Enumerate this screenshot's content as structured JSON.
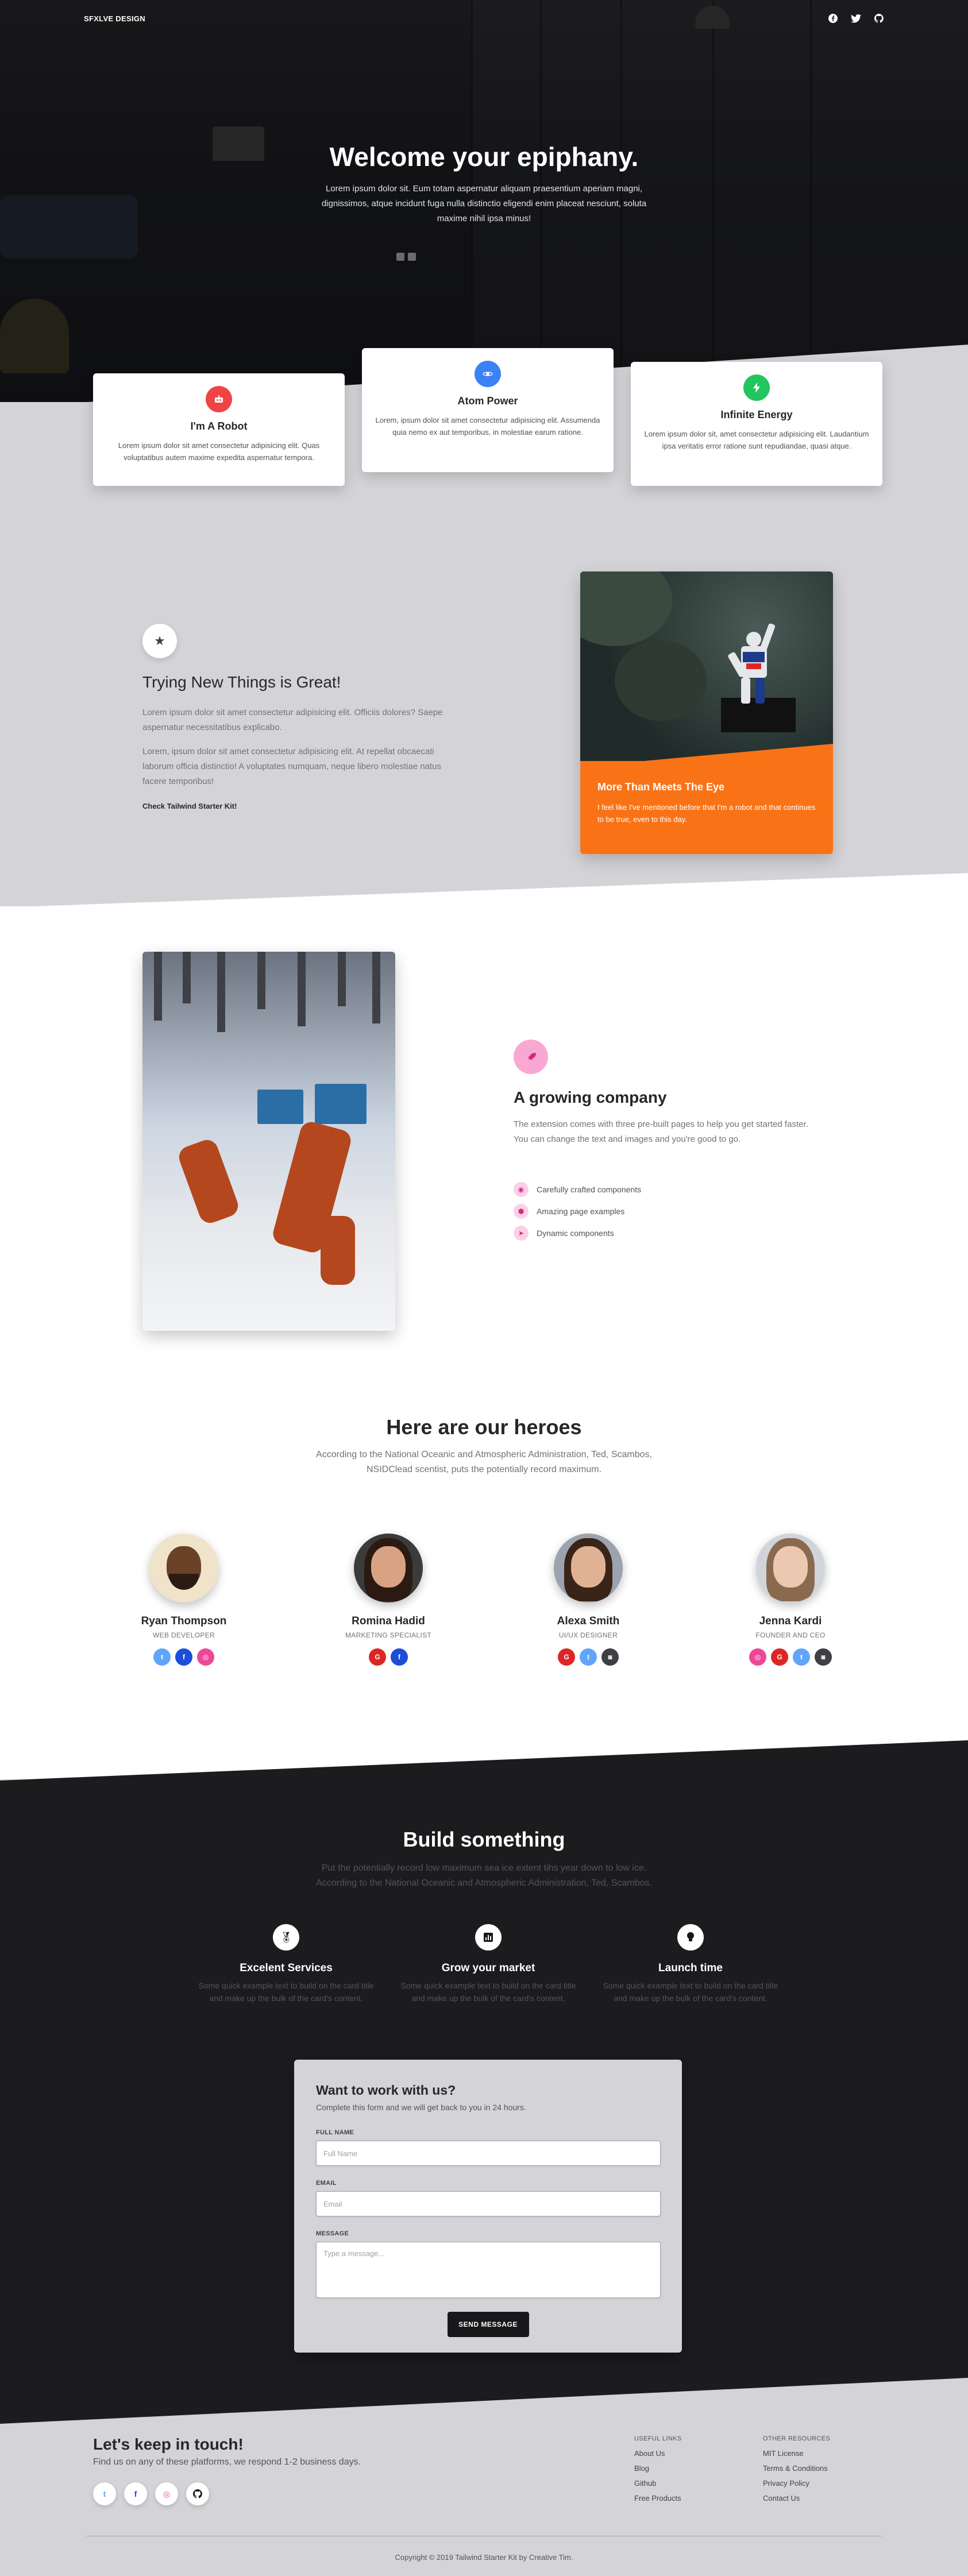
{
  "nav": {
    "brand": "SFXLVE DESIGN",
    "social_icons": [
      "facebook-icon",
      "twitter-icon",
      "github-icon"
    ]
  },
  "hero": {
    "title": "Welcome your epiphany.",
    "subtitle_lines": [
      "Lorem ipsum dolor sit. Eum totam aspernatur aliquam praesentium aperiam magni,",
      "dignissimos, atque incidunt fuga nulla distinctio eligendi enim placeat nesciunt, soluta",
      "maxime nihil ipsa minus!"
    ]
  },
  "features": [
    {
      "title": "I'm A Robot",
      "text": "Lorem ipsum dolor sit amet consectetur adipisicing elit. Quas voluptatibus autem maxime expedita aspernatur tempora.",
      "icon": "robot-icon",
      "color": "#ef4444"
    },
    {
      "title": "Atom Power",
      "text": "Lorem, ipsum dolor sit amet consectetur adipisicing elit. Assumenda quia nemo ex aut temporibus, in molestiae earum ratione.",
      "icon": "atom-icon",
      "color": "#3b82f6"
    },
    {
      "title": "Infinite Energy",
      "text": "Lorem ipsum dolor sit, amet consectetur adipisicing elit. Laudantium ipsa veritatis error ratione sunt repudiandae, quasi atque.",
      "icon": "energy-icon",
      "color": "#22c55e"
    }
  ],
  "section2": {
    "title": "Trying New Things is Great!",
    "p1": "Lorem ipsum dolor sit amet consectetur adipisicing elit. Officiis dolores? Saepe aspernatur necessitatibus explicabo.",
    "p2": "Lorem, ipsum dolor sit amet consectetur adipisicing elit. At repellat obcaecati laborum officia distinctio! A voluptates numquam, neque libero molestiae natus facere temporibus!",
    "link": "Check Tailwind Starter Kit!",
    "card_title": "More Than Meets The Eye",
    "card_text": "I feel like I've mentioned before that I'm a robot and that continues to be true, even to this day."
  },
  "section3": {
    "title": "A growing company",
    "text": "The extension comes with three pre-built pages to help you get started faster. You can change the text and images and you're good to go.",
    "list": [
      "Carefully crafted components",
      "Amazing page examples",
      "Dynamic components"
    ]
  },
  "heroes": {
    "title": "Here are our heroes",
    "subtitle_lines": [
      "According to the National Oceanic and Atmospheric Administration, Ted, Scambos,",
      "NSIDClead scentist, puts the potentially record maximum."
    ],
    "members": [
      {
        "name": "Ryan Thompson",
        "role": "WEB DEVELOPER",
        "socials": [
          "twitter-icon",
          "facebook-icon",
          "dribbble-icon"
        ]
      },
      {
        "name": "Romina Hadid",
        "role": "MARKETING SPECIALIST",
        "socials": [
          "google-icon",
          "facebook-icon"
        ]
      },
      {
        "name": "Alexa Smith",
        "role": "UI/UX DESIGNER",
        "socials": [
          "google-icon",
          "twitter-icon",
          "instagram-icon"
        ]
      },
      {
        "name": "Jenna Kardi",
        "role": "FOUNDER AND CEO",
        "socials": [
          "dribbble-icon",
          "google-icon",
          "twitter-icon",
          "instagram-icon"
        ]
      }
    ]
  },
  "build": {
    "title": "Build something",
    "subtitle_lines": [
      "Put the potentially record low maximum sea ice extent tihs year down to low ice.",
      "According to the National Oceanic and Atmospheric Administration, Ted, Scambos."
    ],
    "services": [
      {
        "title": "Excelent Services",
        "text": "Some quick example text to build on the card title and make up the bulk of the card's content.",
        "icon": "medal-icon"
      },
      {
        "title": "Grow your market",
        "text": "Some quick example text to build on the card title and make up the bulk of the card's content.",
        "icon": "poll-icon"
      },
      {
        "title": "Launch time",
        "text": "Some quick example text to build on the card title and make up the bulk of the card's content.",
        "icon": "lightbulb-icon"
      }
    ]
  },
  "form": {
    "title": "Want to work with us?",
    "subtitle": "Complete this form and we will get back to you in 24 hours.",
    "full_name_label": "FULL NAME",
    "full_name_placeholder": "Full Name",
    "email_label": "EMAIL",
    "email_placeholder": "Email",
    "message_label": "MESSAGE",
    "message_placeholder": "Type a message...",
    "submit": "SEND MESSAGE"
  },
  "footer": {
    "title": "Let's keep in touch!",
    "subtitle": "Find us on any of these platforms, we respond 1-2 business days.",
    "socials": [
      "twitter-icon",
      "facebook-icon",
      "dribbble-icon",
      "github-icon"
    ],
    "useful_links_title": "USEFUL LINKS",
    "useful_links": [
      "About Us",
      "Blog",
      "Github",
      "Free Products"
    ],
    "other_resources_title": "OTHER RESOURCES",
    "other_resources": [
      "MIT License",
      "Terms & Conditions",
      "Privacy Policy",
      "Contact Us"
    ],
    "copyright": "Copyright © 2019 Tailwind Starter Kit by Creative Tim."
  },
  "colors": {
    "accent_orange": "#f97316",
    "dark_bg": "#1c1c1f",
    "light_bg": "#d4d4d8"
  }
}
